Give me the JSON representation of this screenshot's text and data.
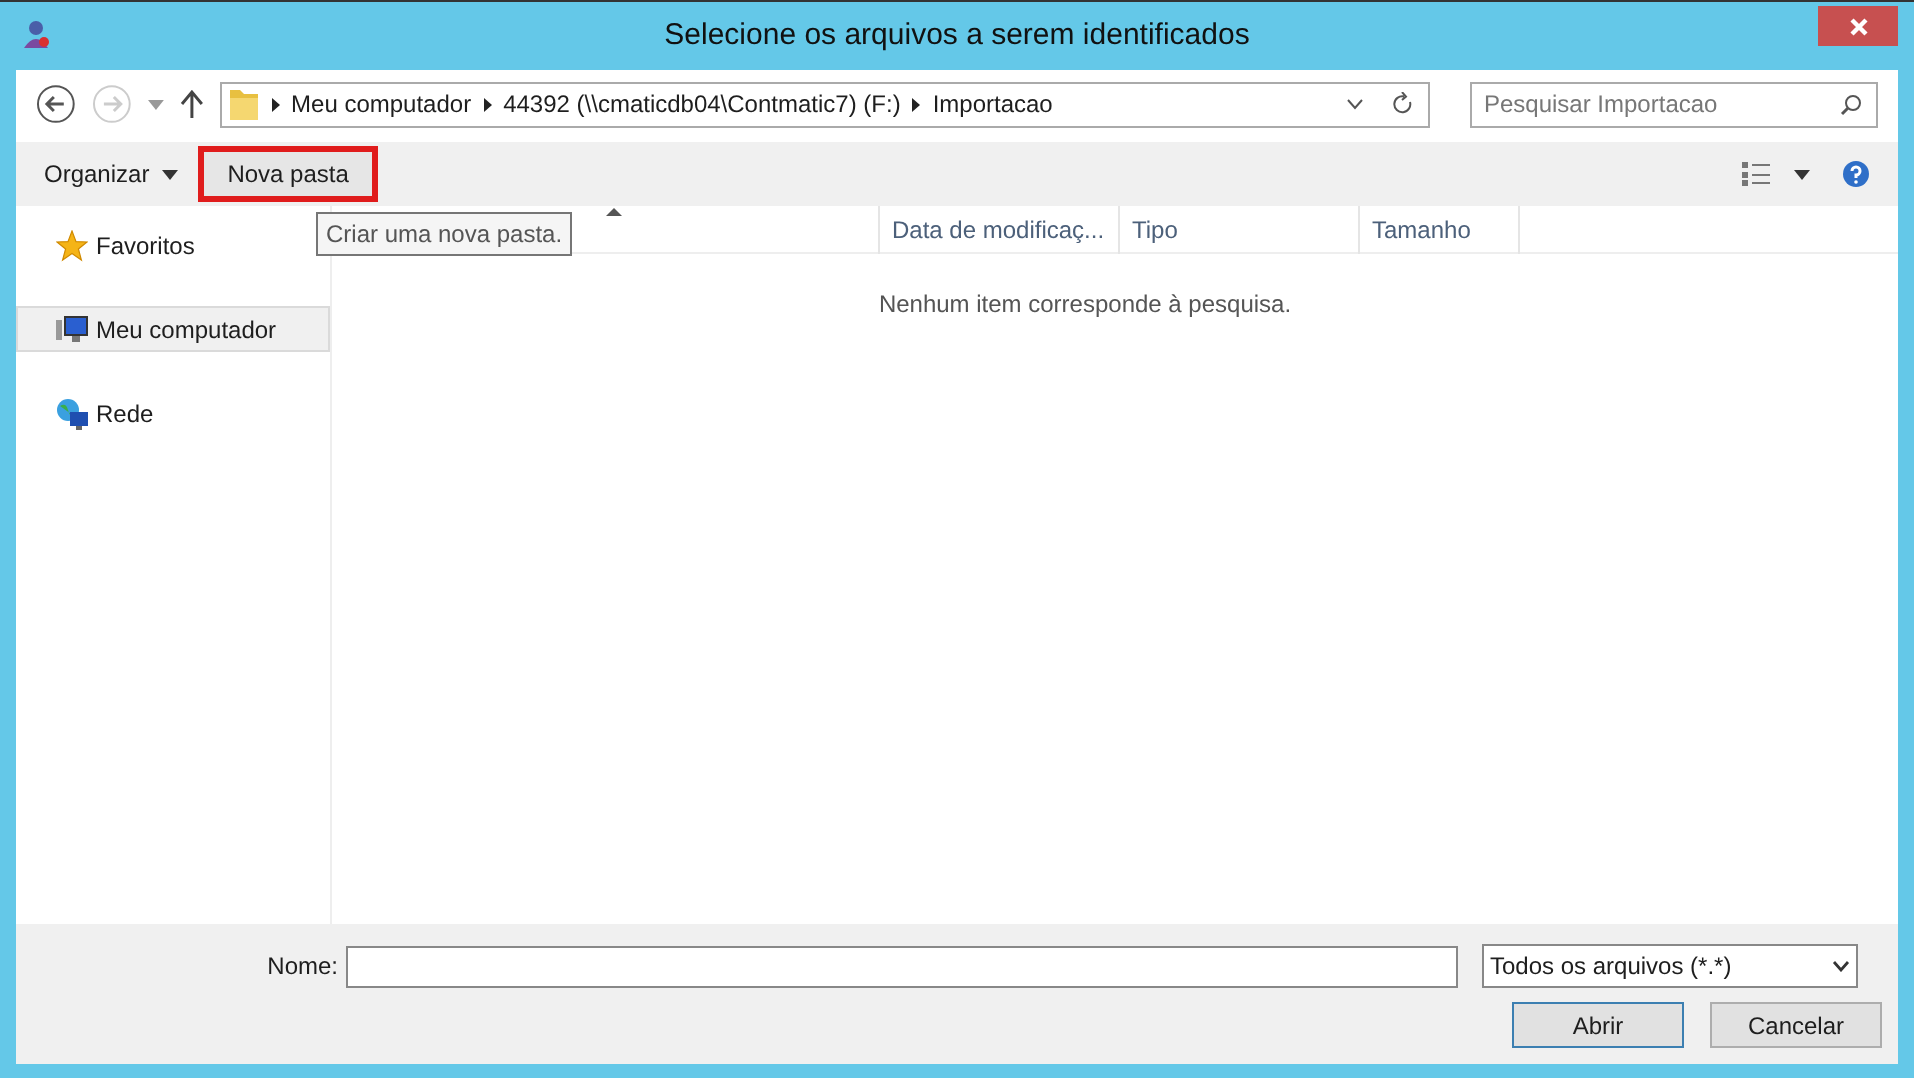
{
  "window": {
    "title": "Selecione os arquivos a serem identificados"
  },
  "address": {
    "segments": [
      "Meu computador",
      "44392 (\\\\cmaticdb04\\Contmatic7) (F:)",
      "Importacao"
    ]
  },
  "search": {
    "placeholder": "Pesquisar Importacao"
  },
  "toolbar": {
    "organize": "Organizar",
    "new_folder": "Nova pasta",
    "tooltip": "Criar uma nova pasta."
  },
  "columns": [
    {
      "sorted": true
    },
    {
      "label": "Data de modificaç...",
      "sorted": false
    },
    {
      "label": "Tipo",
      "sorted": false
    },
    {
      "label": "Tamanho",
      "sorted": false
    }
  ],
  "empty_message": "Nenhum item corresponde à pesquisa.",
  "sidebar": {
    "items": [
      {
        "label": "Favoritos",
        "kind": "star",
        "selected": false
      },
      {
        "label": "Meu computador",
        "kind": "computer",
        "selected": true
      },
      {
        "label": "Rede",
        "kind": "network",
        "selected": false
      }
    ]
  },
  "footer": {
    "name_label": "Nome:",
    "file_type": "Todos os arquivos (*.*)",
    "buttons": [
      "Abrir",
      "Cancelar"
    ]
  }
}
